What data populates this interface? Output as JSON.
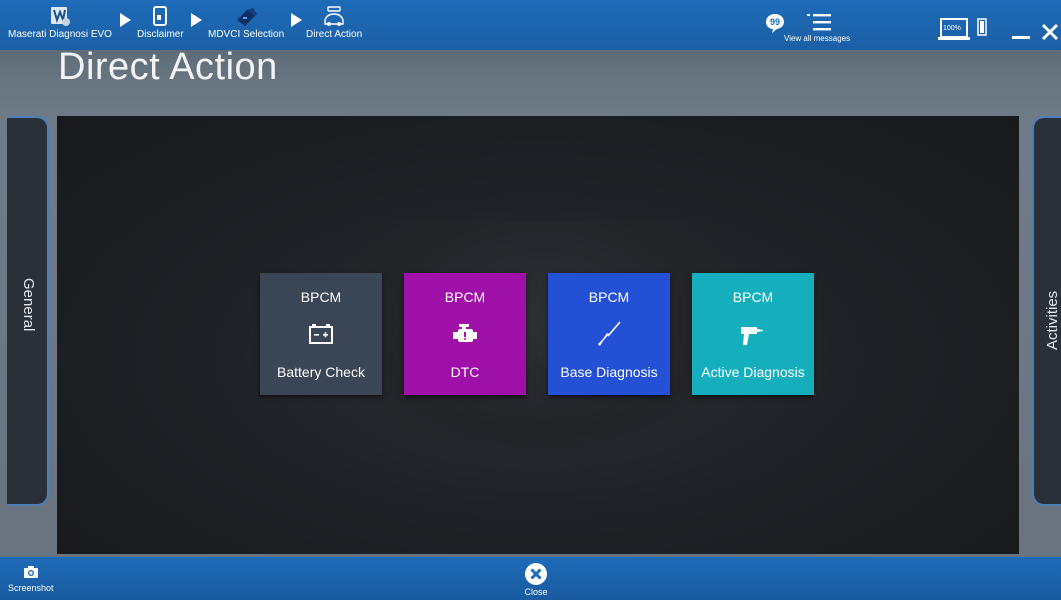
{
  "breadcrumbs": [
    {
      "label": "Maserati Diagnosi EVO",
      "icon": "maserati-app-icon"
    },
    {
      "label": "Disclaimer",
      "icon": "tablet-document-icon"
    },
    {
      "label": "MDVCI Selection",
      "icon": "mdvci-device-icon"
    },
    {
      "label": "Direct Action",
      "icon": "car-icon"
    }
  ],
  "topbar": {
    "messages_label": "View all messages",
    "battery_percent": "100%"
  },
  "page_title": "Direct Action",
  "side_panels": {
    "left": "General",
    "right": "Activities"
  },
  "tiles": [
    {
      "module": "BPCM",
      "label": "Battery Check",
      "icon": "battery-icon",
      "color": "#3a4555"
    },
    {
      "module": "BPCM",
      "label": "DTC",
      "icon": "engine-icon",
      "color": "#9e10a8"
    },
    {
      "module": "BPCM",
      "label": "Base Diagnosis",
      "icon": "screwdriver-icon",
      "color": "#2450d6"
    },
    {
      "module": "BPCM",
      "label": "Active Diagnosis",
      "icon": "drill-icon",
      "color": "#14aebc"
    }
  ],
  "bottombar": {
    "screenshot_label": "Screenshot",
    "close_label": "Close"
  }
}
